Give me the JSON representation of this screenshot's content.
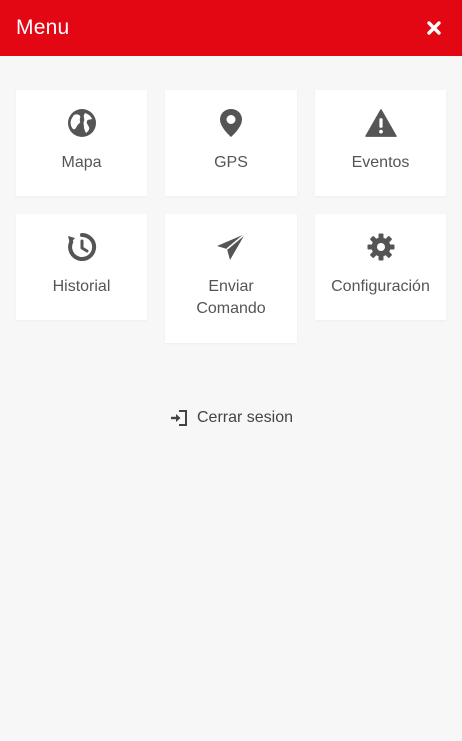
{
  "header": {
    "title": "Menu",
    "close_icon": "close-icon",
    "background": "#e30613"
  },
  "tiles": [
    {
      "label": "Mapa",
      "icon": "globe-icon"
    },
    {
      "label": "GPS",
      "icon": "map-marker-icon"
    },
    {
      "label": "Eventos",
      "icon": "warning-icon"
    },
    {
      "label": "Historial",
      "icon": "history-icon"
    },
    {
      "label_line1": "Enviar",
      "label_line2": "Comando",
      "icon": "send-icon"
    },
    {
      "label": "Configuración",
      "icon": "gear-icon"
    }
  ],
  "logout": {
    "label": "Cerrar sesion",
    "icon": "sign-out-icon"
  },
  "colors": {
    "accent": "#e30613",
    "icon": "#555555",
    "tile_bg": "#ffffff",
    "page_bg": "#f7f7f7"
  }
}
